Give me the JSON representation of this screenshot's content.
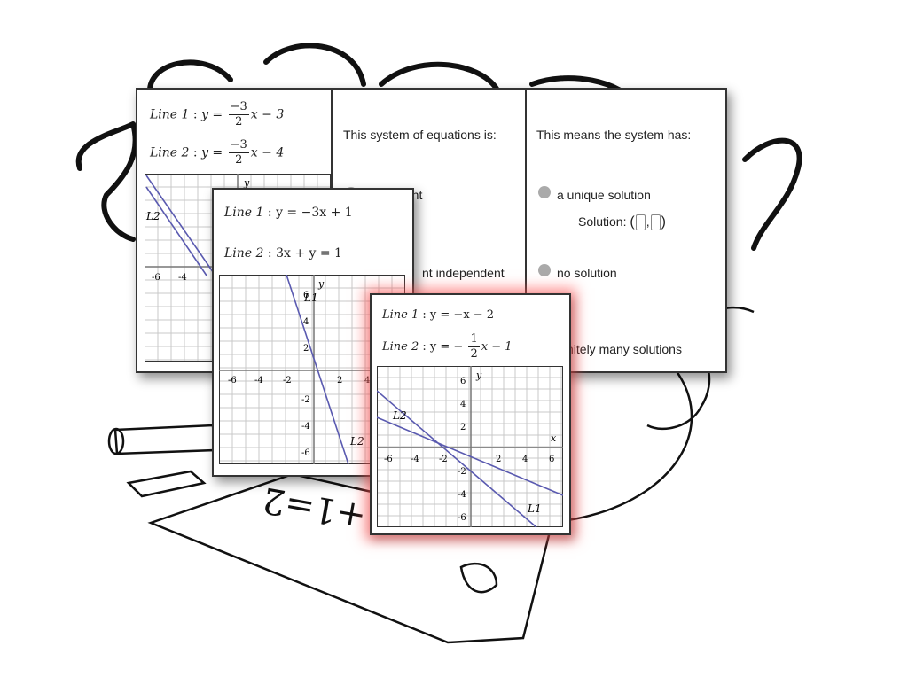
{
  "top_card": {
    "line1": {
      "label": "Line 1",
      "lhs": "y",
      "num": "−3",
      "den": "2",
      "rest": "x − 3"
    },
    "line2": {
      "label": "Line 2",
      "lhs": "y",
      "num": "−3",
      "den": "2",
      "rest": "x − 4"
    },
    "graph": {
      "ticks_x": [
        "-6",
        "-4"
      ],
      "line_label": "L2",
      "axis_y": "y"
    },
    "middle_panel": {
      "heading": "This system of equations is:",
      "option1_fragment": "tent",
      "option2_fragment": "nt independent"
    },
    "right_panel": {
      "heading": "This means the system has:",
      "option1": "a unique solution",
      "solution_label": "Solution:",
      "option2": "no solution",
      "option3_fragment": "finitely many solutions"
    }
  },
  "mid_card": {
    "line1": {
      "label": "Line 1",
      "eq": "y = −3x + 1"
    },
    "line2": {
      "label": "Line 2",
      "eq": "3x + y = 1"
    },
    "graph": {
      "ticks_x": [
        "-6",
        "-4",
        "-2",
        "2",
        "4"
      ],
      "ticks_y": [
        "6",
        "4",
        "2",
        "-2",
        "-4",
        "-6"
      ],
      "label_l1": "L1",
      "label_l2": "L2",
      "axis_y": "y"
    }
  },
  "front_card": {
    "line1": {
      "label": "Line 1",
      "eq": "y = −x − 2"
    },
    "line2": {
      "label": "Line 2",
      "lhs": "y = −",
      "num": "1",
      "den": "2",
      "rest": "x − 1"
    },
    "graph": {
      "ticks_x": [
        "-6",
        "-4",
        "-2",
        "2",
        "4",
        "6"
      ],
      "ticks_y": [
        "6",
        "4",
        "2",
        "-2",
        "-4",
        "-6"
      ],
      "label_l1": "L1",
      "label_l2": "L2",
      "axis_x": "x",
      "axis_y": "y"
    }
  },
  "background": {
    "chalk_equation": "1+1=2"
  },
  "colors": {
    "line": "#5a5ab0",
    "grid": "#c8c8c8",
    "glow": "#ff5050"
  }
}
